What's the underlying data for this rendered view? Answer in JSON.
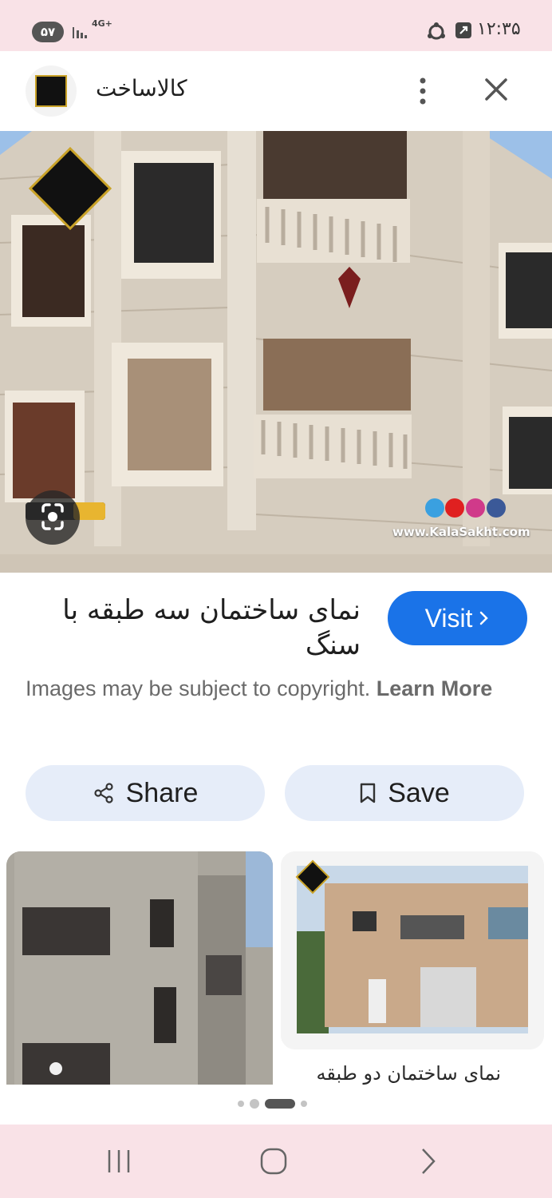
{
  "status_bar": {
    "battery": "۵۷",
    "network": "4G+",
    "time": "۱۲:۳۵"
  },
  "header": {
    "site_name": "کالاساخت",
    "more_icon": "more-vert-icon",
    "close_icon": "close-icon"
  },
  "main_image": {
    "watermark": "www.KalaSakht.com",
    "lens_icon": "google-lens-icon"
  },
  "details": {
    "title": "نمای ساختمان سه طبقه با سنگ",
    "visit_label": "Visit",
    "copyright_text": "Images may be subject to copyright.",
    "learn_more": "Learn More",
    "share_label": "Share",
    "save_label": "Save"
  },
  "related": {
    "right_caption": "نمای ساختمان دو طبقه"
  },
  "colors": {
    "accent": "#1a73e8",
    "action_bg": "#e6edf9",
    "system_bar": "#f9e2e7"
  }
}
